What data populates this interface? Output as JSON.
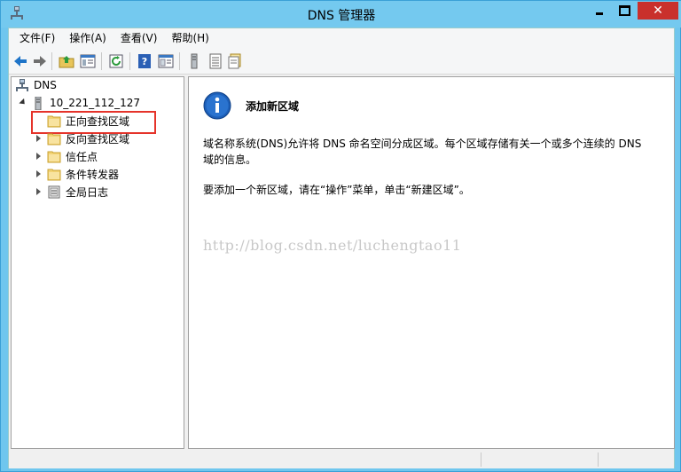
{
  "window": {
    "title": "DNS 管理器"
  },
  "menubar": [
    {
      "label": "文件(F)"
    },
    {
      "label": "操作(A)"
    },
    {
      "label": "查看(V)"
    },
    {
      "label": "帮助(H)"
    }
  ],
  "toolbar": {
    "icons": [
      "back-arrow-icon",
      "forward-arrow-icon",
      "up-folder-icon",
      "show-hide-tree-icon",
      "refresh-icon",
      "help-icon",
      "properties-icon",
      "server-icon",
      "list-icon",
      "export-icon"
    ]
  },
  "tree": {
    "root": "DNS",
    "server": "10_221_112_127",
    "children": [
      {
        "label": "正向查找区域"
      },
      {
        "label": "反向查找区域"
      },
      {
        "label": "信任点"
      },
      {
        "label": "条件转发器"
      },
      {
        "label": "全局日志"
      }
    ]
  },
  "content": {
    "heading": "添加新区域",
    "paragraph1_line1": "域名称系统(DNS)允许将 DNS 命名空间分成区域。每个区域存储有关一个或多个连续的 DNS",
    "paragraph1_line2": "域的信息。",
    "paragraph2": "要添加一个新区域，请在“操作”菜单，单击“新建区域”。",
    "watermark": "http://blog.csdn.net/luchengtao11"
  },
  "colors": {
    "highlight_box": "#e5332a",
    "title_bar": "#74c9ef",
    "close_button": "#c9302c",
    "info_icon": "#1d5fb8"
  }
}
